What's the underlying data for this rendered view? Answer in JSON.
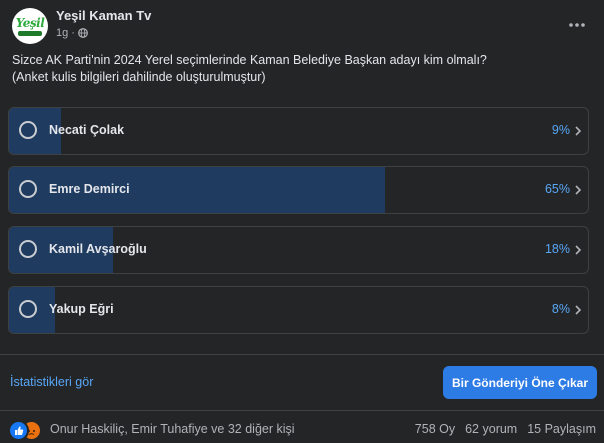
{
  "post": {
    "page_name": "Yeşil Kaman Tv",
    "time": "1g",
    "avatar_text": "Yeşil",
    "question": "Sizce AK Parti'nin 2024 Yerel seçimlerinde Kaman Belediye Başkan adayı kim olmalı?\n(Anket kulis bilgileri dahilinde oluşturulmuştur)"
  },
  "poll": {
    "options": [
      {
        "label": "Necati Çolak",
        "percent_text": "9%",
        "percent": 9
      },
      {
        "label": "Emre Demirci",
        "percent_text": "65%",
        "percent": 65
      },
      {
        "label": "Kamil Avşaroğlu",
        "percent_text": "18%",
        "percent": 18
      },
      {
        "label": "Yakup Eğri",
        "percent_text": "8%",
        "percent": 8
      }
    ]
  },
  "actions": {
    "stats_link": "İstatistikleri gör",
    "boost_button": "Bir Gönderiyi Öne Çıkar"
  },
  "footer": {
    "reactors": "Onur Haskiliç, Emir Tuhafiye ve 32 diğer kişi",
    "votes": "758 Oy",
    "comments": "62 yorum",
    "shares": "15 Paylaşım"
  },
  "colors": {
    "background": "#242526",
    "bar_fill": "#1f3c60",
    "accent": "#58a7f7",
    "button": "#2d7be5"
  }
}
